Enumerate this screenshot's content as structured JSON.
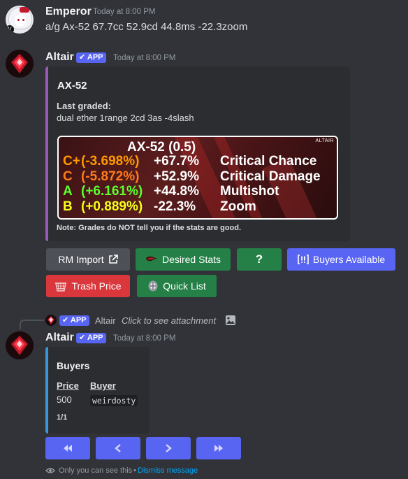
{
  "messages": [
    {
      "author": "Emperor",
      "timestamp": "Today at 8:00 PM",
      "text": "a/g Ax-52 67.7cc 52.9cd 44.8ms -22.3zoom"
    },
    {
      "author": "Altair",
      "app_tag": "APP",
      "timestamp": "Today at 8:00 PM",
      "embed": {
        "title": "AX-52",
        "last_graded_label": "Last graded:",
        "last_graded_value": "dual ether 1range 2cd 3as -4slash",
        "image": {
          "watermark": "ALTAIR",
          "heading": "AX-52 (0.5)",
          "rows": [
            {
              "grade": "C+",
              "delta": "(-3.698%)",
              "value": "+67.7%",
              "stat": "Critical Chance",
              "color": "#ff9900"
            },
            {
              "grade": "C",
              "delta": "(-5.872%)",
              "value": "+52.9%",
              "stat": "Critical Damage",
              "color": "#ff7a1a"
            },
            {
              "grade": "A",
              "delta": "(+6.161%)",
              "value": "+44.8%",
              "stat": "Multishot",
              "color": "#5dff2e"
            },
            {
              "grade": "B",
              "delta": "(+0.889%)",
              "value": "-22.3%",
              "stat": "Zoom",
              "color": "#f2ff1a"
            }
          ]
        },
        "note": "Note: Grades do NOT tell you if the stats are good.",
        "accent": "#9b59b6"
      },
      "buttons": [
        {
          "label": "RM Import",
          "icon": "external-link-icon",
          "style": "gray"
        },
        {
          "label": "Desired Stats",
          "icon": "kuva-icon",
          "style": "green"
        },
        {
          "label": "?",
          "style": "green"
        },
        {
          "label": "Buyers Available",
          "icon": "alert-brackets-icon",
          "style": "blurple"
        },
        {
          "label": "Trash Price",
          "icon": "trash-basket-icon",
          "style": "red"
        },
        {
          "label": "Quick List",
          "icon": "relic-icon",
          "style": "green"
        }
      ]
    },
    {
      "author": "Altair",
      "app_tag": "APP",
      "timestamp": "Today at 8:00 PM",
      "reply": {
        "author": "Altair",
        "app_tag": "APP",
        "text": "Click to see attachment"
      },
      "embed": {
        "title": "Buyers",
        "col_price": "Price",
        "col_buyer": "Buyer",
        "price": "500",
        "buyer": "weirdosty",
        "page": "1/1",
        "accent": "#3498db"
      },
      "nav_buttons": [
        "first-page-icon",
        "prev-page-icon",
        "next-page-icon",
        "last-page-icon"
      ],
      "ephemeral": {
        "text": "Only you can see this",
        "separator": "•",
        "link": "Dismiss message"
      }
    }
  ]
}
